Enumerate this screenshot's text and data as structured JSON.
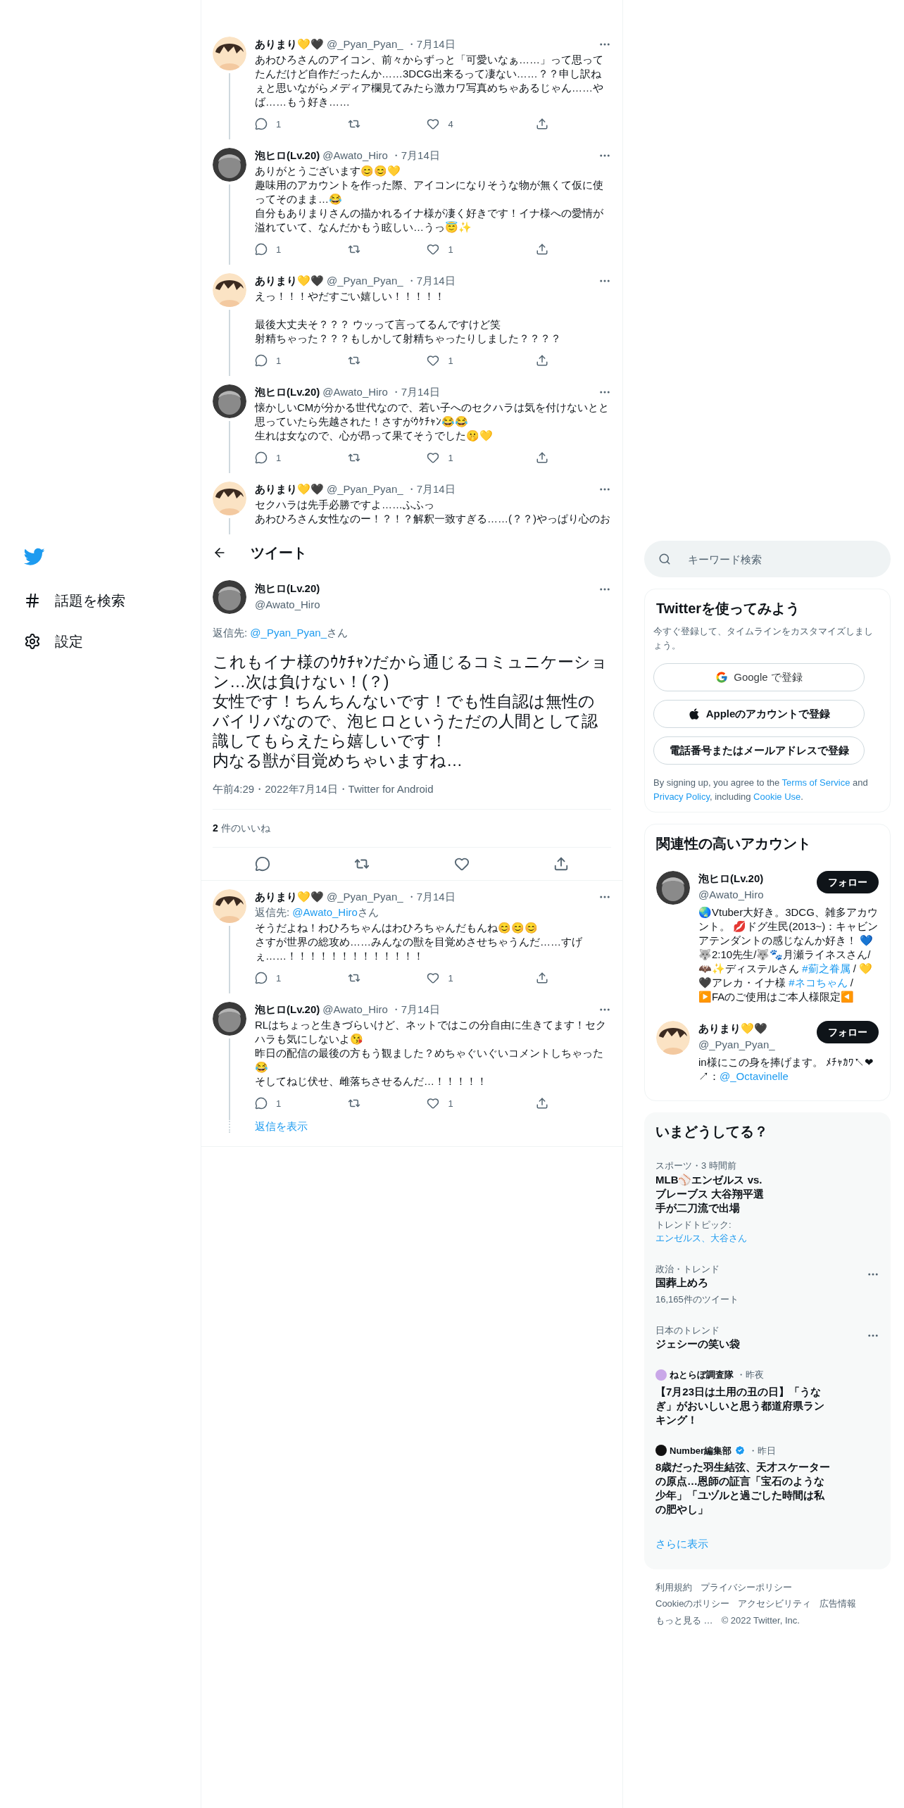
{
  "sidebar": {
    "items": [
      {
        "kind": "explore",
        "label": "話題を検索"
      },
      {
        "kind": "settings",
        "label": "設定"
      }
    ]
  },
  "thread_above": [
    {
      "name": "ありまり💛🖤",
      "handle": "@_Pyan_Pyan_",
      "date": "・7月14日",
      "avatar": {
        "kind": "drawn"
      },
      "paragraphs": [
        [
          "あわひろさんのアイコン、前々からずっと「可愛いなぁ……」って思ってたんだけど自作だったんか……3DCG出来るって凄ない……？？申し訳ねぇと思いながらメディア欄見てみたら激カワ写真めちゃあるじゃん……やば……もう好き……"
        ]
      ],
      "actions": {
        "replies": "1",
        "likes": "4"
      }
    },
    {
      "name": "泡ヒロ(Lv.20)",
      "handle": "@Awato_Hiro",
      "date": "・7月14日",
      "avatar": {
        "kind": "sculpture"
      },
      "paragraphs": [
        [
          "ありがとうございます😊😊💛",
          "趣味用のアカウントを作った際、アイコンになりそうな物が無くて仮に使ってそのまま…😂",
          "自分もありまりさんの描かれるイナ様が凄く好きです！イナ様への愛情が溢れていて、なんだかもう眩しい…うっ😇✨"
        ]
      ],
      "actions": {
        "replies": "1",
        "likes": "1"
      }
    },
    {
      "name": "ありまり💛🖤",
      "handle": "@_Pyan_Pyan_",
      "date": "・7月14日",
      "avatar": {
        "kind": "drawn"
      },
      "paragraphs": [
        [
          "えっ！！！やだすごい嬉しい！！！！！"
        ],
        [
          "最後大丈夫そ？？？ ウッって言ってるんですけど笑",
          "射精ちゃった？？？もしかして射精ちゃったりしました？？？？"
        ]
      ],
      "actions": {
        "replies": "1",
        "likes": "1"
      }
    },
    {
      "name": "泡ヒロ(Lv.20)",
      "handle": "@Awato_Hiro",
      "date": "・7月14日",
      "avatar": {
        "kind": "sculpture"
      },
      "paragraphs": [
        [
          "懐かしいCMが分かる世代なので、若い子へのセクハラは気を付けないとと思っていたら先越された！さすがｳｹﾁｬﾝ😂😂",
          "生れは女なので、心が昂って果てそうでした🤫💛"
        ]
      ],
      "actions": {
        "replies": "1",
        "likes": "1"
      }
    },
    {
      "name": "ありまり💛🖤",
      "handle": "@_Pyan_Pyan_",
      "date": "・7月14日",
      "avatar": {
        "kind": "drawn"
      },
      "paragraphs": [
        [
          "セクハラは先手必勝ですよ……ふふっ",
          "あわひろさん女性なのー！？！？解釈一致すぎる……(？？)やっぱり心のお"
        ]
      ]
    }
  ],
  "header": {
    "title": "ツイート"
  },
  "main_tweet": {
    "name": "泡ヒロ(Lv.20)",
    "handle": "@Awato_Hiro",
    "avatar": {
      "kind": "sculpture"
    },
    "reply_to": [
      {
        "text": "返信先: ",
        "link": false
      },
      {
        "text": "@_Pyan_Pyan_",
        "link": true
      },
      {
        "text": "さん",
        "link": false
      }
    ],
    "lines": [
      "これもイナ様のｳｹﾁｬﾝだから通じるコミュニケーション…次は負けない！(？)",
      "女性です！ちんちんないです！でも性自認は無性のバイリバなので、泡ヒロというただの人間として認識してもらえたら嬉しいです！",
      "内なる獣が目覚めちゃいますね…"
    ],
    "meta": "午前4:29・2022年7月14日・Twitter for Android",
    "likes": "2",
    "likes_label": "件のいいね"
  },
  "replies": [
    {
      "name": "ありまり💛🖤",
      "handle": "@_Pyan_Pyan_",
      "date": "・7月14日",
      "avatar": {
        "kind": "drawn"
      },
      "reply_to": [
        {
          "text": "返信先: ",
          "link": false
        },
        {
          "text": "@Awato_Hiro",
          "link": true
        },
        {
          "text": "さん",
          "link": false
        }
      ],
      "paragraphs": [
        [
          "そうだよね！わひろちゃんはわひろちゃんだもんね😊😊😊",
          "さすが世界の総攻め……みんなの獣を目覚めさせちゃうんだ……すげぇ……！！！！！！！！！！！！！"
        ]
      ],
      "actions": {
        "replies": "1",
        "likes": "1"
      }
    },
    {
      "name": "泡ヒロ(Lv.20)",
      "handle": "@Awato_Hiro",
      "date": "・7月14日",
      "avatar": {
        "kind": "sculpture"
      },
      "paragraphs": [
        [
          "RLはちょっと生きづらいけど、ネットではこの分自由に生きてます！セクハラも気にしないよ😘",
          "昨日の配信の最後の方もう観ました？めちゃぐいぐいコメントしちゃった😂",
          "そしてねじ伏せ、雌落ちさせるんだ…！！！！！"
        ]
      ],
      "actions": {
        "replies": "1",
        "likes": "1"
      }
    }
  ],
  "show_replies": "返信を表示",
  "search": {
    "placeholder": "キーワード検索"
  },
  "signup": {
    "title": "Twitterを使ってみよう",
    "subtitle": "今すぐ登録して、タイムラインをカスタマイズしましょう。",
    "buttons": [
      {
        "kind": "google",
        "label": "Google で登録"
      },
      {
        "kind": "apple",
        "label": "Appleのアカウントで登録"
      },
      {
        "kind": "plain",
        "label": "電話番号またはメールアドレスで登録"
      }
    ],
    "legal": [
      {
        "text": "By signing up, you agree to the ",
        "link": false
      },
      {
        "text": "Terms of Service",
        "link": true
      },
      {
        "text": " and ",
        "link": false
      },
      {
        "text": "Privacy Policy",
        "link": true
      },
      {
        "text": ", including ",
        "link": false
      },
      {
        "text": "Cookie Use",
        "link": true
      },
      {
        "text": ".",
        "link": false
      }
    ]
  },
  "who_to_follow": {
    "title": "関連性の高いアカウント",
    "accounts": [
      {
        "name": "泡ヒロ(Lv.20)",
        "handle": "@Awato_Hiro",
        "avatar": {
          "kind": "sculpture"
        },
        "button": "フォロー",
        "bio": [
          {
            "text": "🌏Vtuber大好き。3DCG、雑多アカウント。 💋ドグ生民(2013~)：キャビンアテンダントの感じなんか好き！ 💙🐺2:10先生/🐺🐾月瀬ライネスさん/🦇✨ディステルさん ",
            "link": false
          },
          {
            "text": "#薊之眷属",
            "link": true
          },
          {
            "text": " / 💛🖤アレカ・イナ様 ",
            "link": false
          },
          {
            "text": "#ネコちゃん",
            "link": true
          },
          {
            "text": " / ▶️FAのご使用はご本人様限定◀️",
            "link": false
          }
        ]
      },
      {
        "name": "ありまり💛🖤",
        "handle": "@_Pyan_Pyan_",
        "avatar": {
          "kind": "drawn"
        },
        "button": "フォロー",
        "bio": [
          {
            "text": "in様にこの身を捧げます。 ﾒﾁｬｶﾜ↖❤↗：",
            "link": false
          },
          {
            "text": "@_Octavinelle",
            "link": true
          }
        ]
      }
    ]
  },
  "trends": {
    "title": "いまどうしてる？",
    "items": [
      {
        "kind": "trend",
        "context": "スポーツ・3 時間前",
        "title": "MLB⚾エンゼルス vs. ブレーブス 大谷翔平選手が二刀流で出場",
        "topic": [
          {
            "text": "トレンドトピック: ",
            "link": false
          },
          {
            "text": "エンゼルス、大谷さん",
            "link": true
          }
        ],
        "menu": false
      },
      {
        "kind": "trend",
        "context": "政治・トレンド",
        "title": "国葬上めろ",
        "count": "16,165件のツイート",
        "menu": true
      },
      {
        "kind": "trend",
        "context": "日本のトレンド",
        "title": "ジェシーの笑い袋",
        "menu": true
      },
      {
        "kind": "news",
        "source": "ねとらぼ調査隊",
        "verified": false,
        "time": "・昨夜",
        "title": "【7月23日は土用の丑の日】「うなぎ」がおいしいと思う都道府県ランキング！"
      },
      {
        "kind": "news",
        "source": "Number編集部",
        "verified": true,
        "time": "・昨日",
        "title": "8歳だった羽生結弦、天才スケーターの原点…恩師の証言「宝石のような少年」「ユヅルと過ごした時間は私の肥やし」"
      }
    ],
    "more": "さらに表示"
  },
  "footer": {
    "links": [
      "利用規約",
      "プライバシーポリシー",
      "Cookieのポリシー",
      "アクセシビリティ",
      "広告情報",
      "もっと見る …",
      "© 2022 Twitter, Inc."
    ]
  }
}
